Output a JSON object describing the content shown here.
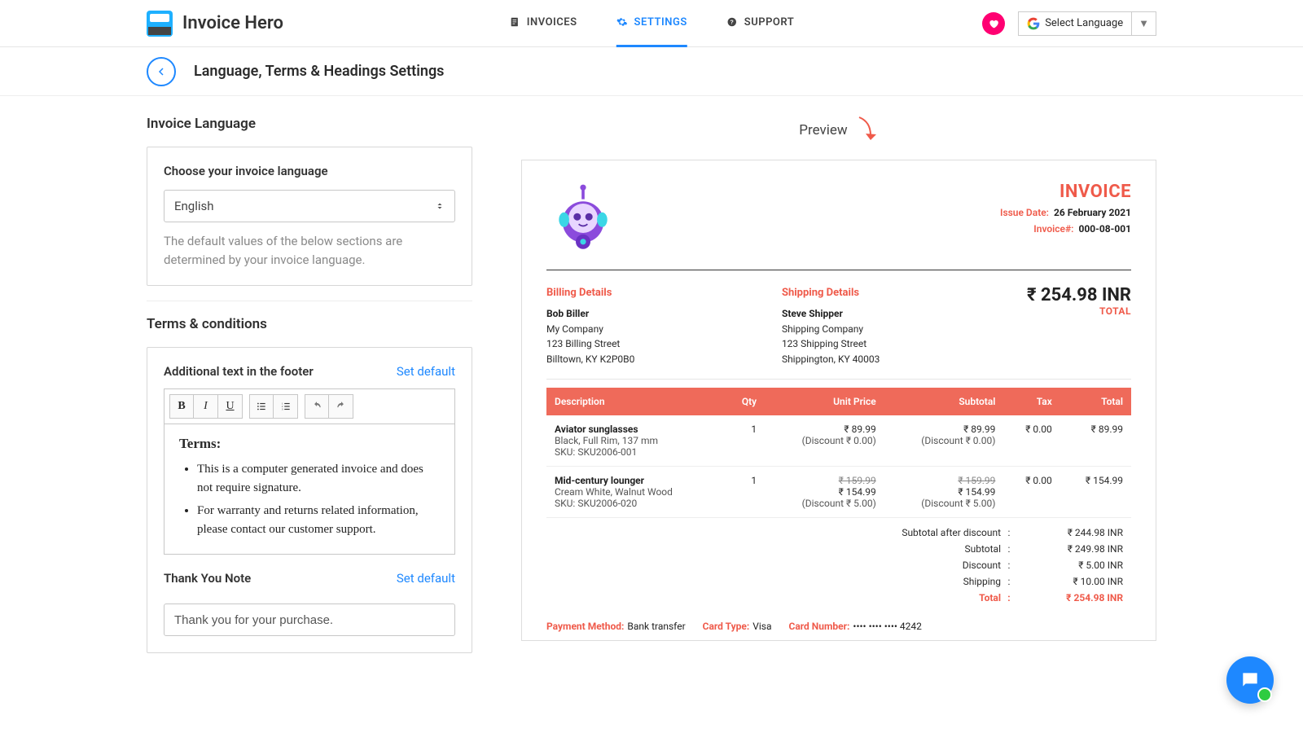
{
  "brand": {
    "name": "Invoice Hero"
  },
  "nav": {
    "invoices": "INVOICES",
    "settings": "SETTINGS",
    "support": "SUPPORT"
  },
  "topright": {
    "language_select": "Select Language"
  },
  "subheader": {
    "title": "Language, Terms & Headings Settings"
  },
  "lang_section": {
    "heading": "Invoice Language",
    "choose_label": "Choose your invoice language",
    "selected": "English",
    "helper": "The default values of the below sections are determined by your invoice language."
  },
  "terms_section": {
    "heading": "Terms & conditions",
    "footer_label": "Additional text in the footer",
    "set_default": "Set default",
    "terms_heading": "Terms:",
    "terms_items": [
      "This is a computer generated invoice and does not require signature.",
      "For warranty and returns related information, please contact our customer support."
    ],
    "thankyou_label": "Thank You Note",
    "thankyou_value": "Thank you for your purchase."
  },
  "preview": {
    "label": "Preview",
    "invoice_title": "INVOICE",
    "issue_date_k": "Issue Date:",
    "issue_date_v": "26 February 2021",
    "invoice_no_k": "Invoice#:",
    "invoice_no_v": "000-08-001",
    "billing_h": "Billing Details",
    "billing": {
      "name": "Bob Biller",
      "company": "My Company",
      "street": "123 Billing Street",
      "city": "Billtown, KY K2P0B0"
    },
    "shipping_h": "Shipping Details",
    "shipping": {
      "name": "Steve Shipper",
      "company": "Shipping Company",
      "street": "123 Shipping Street",
      "city": "Shippington, KY 40003"
    },
    "total_amount": "₹ 254.98 INR",
    "total_label": "TOTAL",
    "cols": {
      "desc": "Description",
      "qty": "Qty",
      "unit": "Unit Price",
      "sub": "Subtotal",
      "tax": "Tax",
      "total": "Total"
    },
    "items": [
      {
        "name": "Aviator sunglasses",
        "variant": "Black, Full Rim, 137 mm",
        "sku": "SKU: SKU2006-001",
        "qty": "1",
        "unit": "₹ 89.99",
        "unit_disc": "(Discount ₹ 0.00)",
        "sub": "₹ 89.99",
        "sub_disc": "(Discount ₹ 0.00)",
        "tax": "₹ 0.00",
        "total": "₹ 89.99"
      },
      {
        "name": "Mid-century lounger",
        "variant": "Cream White, Walnut Wood",
        "sku": "SKU: SKU2006-020",
        "qty": "1",
        "unit_strike": "₹ 159.99",
        "unit": "₹ 154.99",
        "unit_disc": "(Discount ₹ 5.00)",
        "sub_strike": "₹ 159.99",
        "sub": "₹ 154.99",
        "sub_disc": "(Discount ₹ 5.00)",
        "tax": "₹ 0.00",
        "total": "₹ 154.99"
      }
    ],
    "summary": [
      {
        "l": "Subtotal after discount",
        "v": "₹ 244.98 INR"
      },
      {
        "l": "Subtotal",
        "v": "₹ 249.98 INR"
      },
      {
        "l": "Discount",
        "v": "₹ 5.00 INR"
      },
      {
        "l": "Shipping",
        "v": "₹ 10.00 INR"
      },
      {
        "l": "Total",
        "v": "₹ 254.98 INR",
        "red": true
      }
    ],
    "payment": {
      "method_k": "Payment Method:",
      "method_v": "Bank transfer",
      "card_type_k": "Card Type:",
      "card_type_v": "Visa",
      "card_num_k": "Card Number:",
      "card_num_v": "•••• •••• •••• 4242"
    }
  }
}
